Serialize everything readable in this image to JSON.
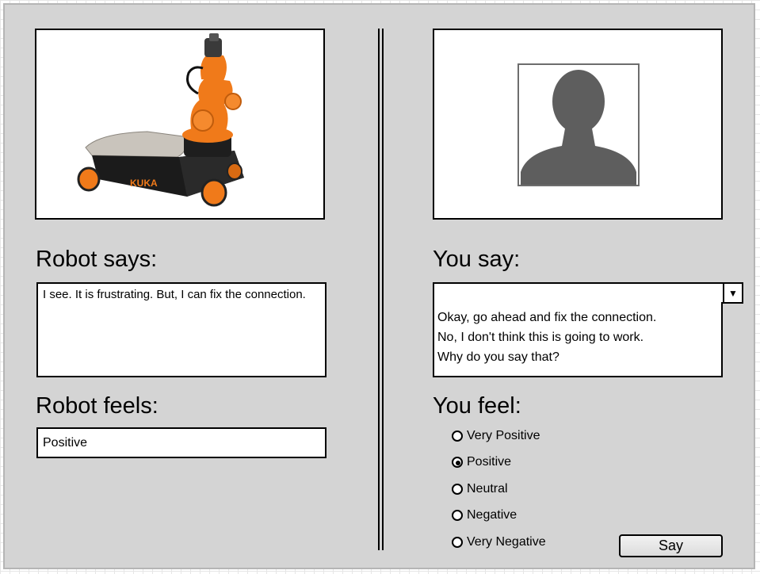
{
  "robot": {
    "says_heading": "Robot says:",
    "says_text": "I see. It is frustrating. But, I can fix the connection.",
    "feels_heading": "Robot feels:",
    "feels_value": "Positive",
    "image_logo": "KUKA"
  },
  "user": {
    "say_heading": "You say:",
    "dropdown_value": "",
    "dropdown_icon": "triangle-down-icon",
    "options": [
      "Okay, go ahead and fix the connection.",
      "No, I don't think this is going to work.",
      "Why do you say that?"
    ],
    "feel_heading": "You feel:",
    "feelings": [
      "Very Positive",
      "Positive",
      "Neutral",
      "Negative",
      "Very Negative"
    ],
    "selected_feeling": "Positive"
  },
  "say_button_label": "Say",
  "colors": {
    "panel": "#d4d4d4",
    "robot_orange": "#f07a1a",
    "avatar_gray": "#5e5e5e"
  }
}
